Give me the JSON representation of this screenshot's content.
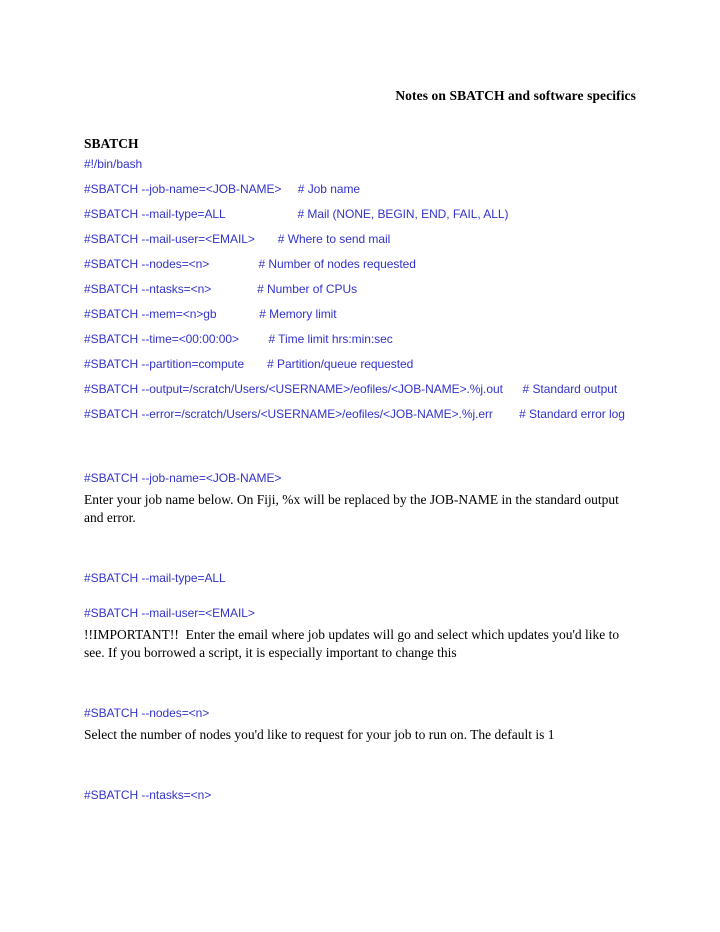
{
  "document": {
    "title": "Notes on SBATCH and software specifics",
    "colors": {
      "code_blue": "#3333CC",
      "body_black": "#000000",
      "page_background": "#FFFFFF"
    }
  },
  "sbatch_section": {
    "heading": "SBATCH",
    "script_lines": [
      "#!/bin/bash",
      "#SBATCH --job-name=<JOB-NAME>     # Job name",
      "#SBATCH --mail-type=ALL                      # Mail (NONE, BEGIN, END, FAIL, ALL)",
      "#SBATCH --mail-user=<EMAIL>       # Where to send mail",
      "#SBATCH --nodes=<n>               # Number of nodes requested",
      "#SBATCH --ntasks=<n>              # Number of CPUs",
      "#SBATCH --mem=<n>gb             # Memory limit",
      "#SBATCH --time=<00:00:00>         # Time limit hrs:min:sec",
      "#SBATCH --partition=compute       # Partition/queue requested",
      "#SBATCH --output=/scratch/Users/<USERNAME>/eofiles/<JOB-NAME>.%j.out      # Standard output",
      "#SBATCH --error=/scratch/Users/<USERNAME>/eofiles/<JOB-NAME>.%j.err        # Standard error log"
    ]
  },
  "explanations": [
    {
      "directive": "#SBATCH --job-name=<JOB-NAME>",
      "body": "Enter your job name below. On Fiji, %x will be replaced by the JOB-NAME in the standard output and error."
    },
    {
      "directive": "#SBATCH --mail-type=ALL",
      "body": ""
    },
    {
      "directive": "#SBATCH --mail-user=<EMAIL>",
      "body": "!!IMPORTANT!!  Enter the email where job updates will go and select which updates you'd like to see. If you borrowed a script, it is especially important to change this"
    },
    {
      "directive": "#SBATCH --nodes=<n>",
      "body": "Select the number of nodes you'd like to request for your job to run on. The default is 1"
    },
    {
      "directive": "#SBATCH --ntasks=<n>",
      "body": ""
    }
  ]
}
